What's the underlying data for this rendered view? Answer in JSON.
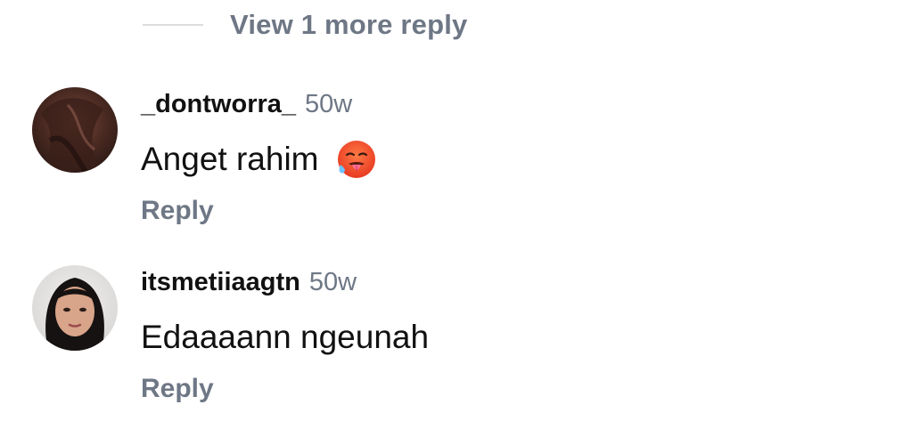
{
  "thread": {
    "view_more_label": "View 1 more reply"
  },
  "comments": [
    {
      "username": "_dontworra_",
      "time": "50w",
      "text": "Anget rahim",
      "emoji": "hot-face-emoji",
      "reply_label": "Reply"
    },
    {
      "username": "itsmetiiaagtn",
      "time": "50w",
      "text": "Edaaaann ngeunah",
      "reply_label": "Reply"
    }
  ]
}
